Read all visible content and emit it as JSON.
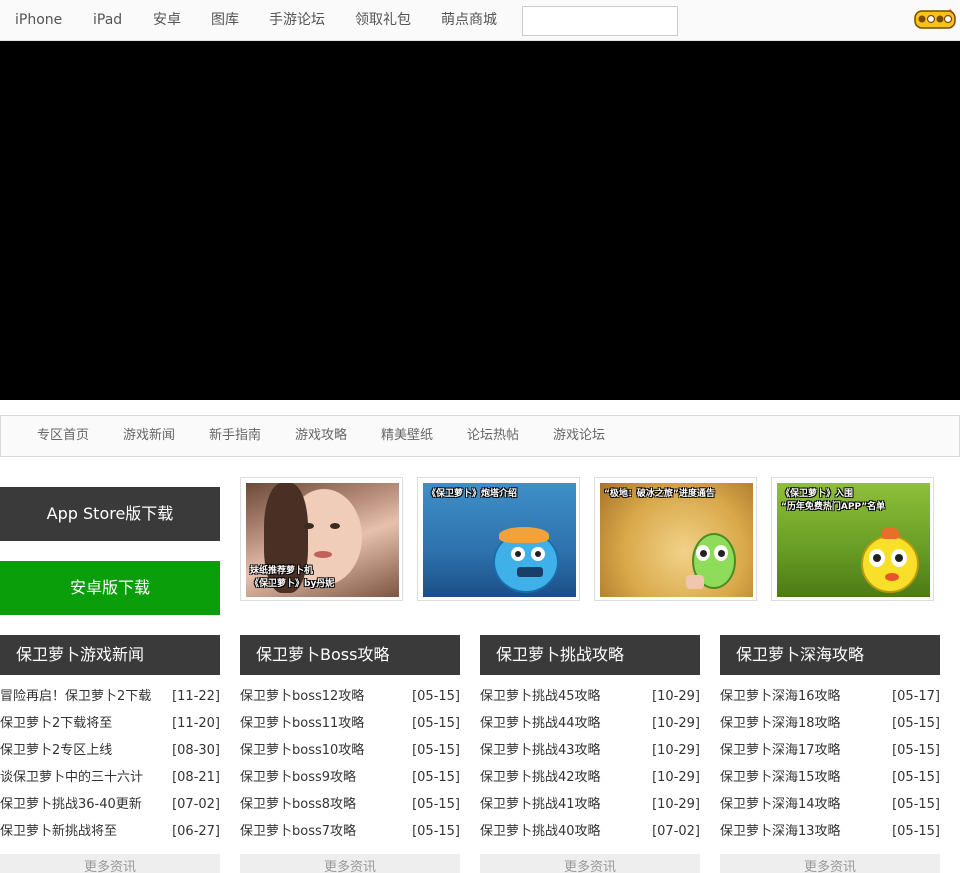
{
  "topnav": {
    "links": [
      "iPhone",
      "iPad",
      "安卓",
      "图库",
      "手游论坛",
      "领取礼包",
      "萌点商城"
    ],
    "search_value": ""
  },
  "subnav": [
    "专区首页",
    "游戏新闻",
    "新手指南",
    "游戏攻略",
    "精美壁纸",
    "论坛热帖",
    "游戏论坛"
  ],
  "downloads": {
    "ios_label": "App Store版下载",
    "android_label": "安卓版下载"
  },
  "thumbnails": [
    {
      "caption_line1": "妹纸推荐萝卜机",
      "caption_line2": "《保卫萝卜》by丹妮"
    },
    {
      "caption_line1": "《保卫萝卜》炮塔介绍",
      "caption_line2": ""
    },
    {
      "caption_line1": "“极地：破冰之旅”进度通告",
      "caption_line2": ""
    },
    {
      "caption_line1": "《保卫萝卜》入围",
      "caption_line2": "“历年免费热门APP”名单"
    }
  ],
  "columns": [
    {
      "title": "保卫萝卜游戏新闻",
      "items": [
        {
          "title": "冒险再启！保卫萝卜2下载",
          "date": "[11-22]"
        },
        {
          "title": "保卫萝卜2下载将至",
          "date": "[11-20]"
        },
        {
          "title": "保卫萝卜2专区上线",
          "date": "[08-30]"
        },
        {
          "title": "谈保卫萝卜中的三十六计",
          "date": "[08-21]"
        },
        {
          "title": "保卫萝卜挑战36-40更新",
          "date": "[07-02]"
        },
        {
          "title": "保卫萝卜新挑战将至",
          "date": "[06-27]"
        }
      ],
      "more": "更多资讯"
    },
    {
      "title": "保卫萝卜Boss攻略",
      "items": [
        {
          "title": "保卫萝卜boss12攻略",
          "date": "[05-15]"
        },
        {
          "title": "保卫萝卜boss11攻略",
          "date": "[05-15]"
        },
        {
          "title": "保卫萝卜boss10攻略",
          "date": "[05-15]"
        },
        {
          "title": "保卫萝卜boss9攻略",
          "date": "[05-15]"
        },
        {
          "title": "保卫萝卜boss8攻略",
          "date": "[05-15]"
        },
        {
          "title": "保卫萝卜boss7攻略",
          "date": "[05-15]"
        }
      ],
      "more": "更多资讯"
    },
    {
      "title": "保卫萝卜挑战攻略",
      "items": [
        {
          "title": "保卫萝卜挑战45攻略",
          "date": "[10-29]"
        },
        {
          "title": "保卫萝卜挑战44攻略",
          "date": "[10-29]"
        },
        {
          "title": "保卫萝卜挑战43攻略",
          "date": "[10-29]"
        },
        {
          "title": "保卫萝卜挑战42攻略",
          "date": "[10-29]"
        },
        {
          "title": "保卫萝卜挑战41攻略",
          "date": "[10-29]"
        },
        {
          "title": "保卫萝卜挑战40攻略",
          "date": "[07-02]"
        }
      ],
      "more": "更多资讯"
    },
    {
      "title": "保卫萝卜深海攻略",
      "items": [
        {
          "title": "保卫萝卜深海16攻略",
          "date": "[05-17]"
        },
        {
          "title": "保卫萝卜深海18攻略",
          "date": "[05-15]"
        },
        {
          "title": "保卫萝卜深海17攻略",
          "date": "[05-15]"
        },
        {
          "title": "保卫萝卜深海15攻略",
          "date": "[05-15]"
        },
        {
          "title": "保卫萝卜深海14攻略",
          "date": "[05-15]"
        },
        {
          "title": "保卫萝卜深海13攻略",
          "date": "[05-15]"
        }
      ],
      "more": "更多资讯"
    }
  ],
  "colors": {
    "dark_button": "#3a3a3a",
    "android_green": "#0a9e0a",
    "video_bg": "#000000"
  },
  "icons": {
    "logo": "18183-logo-icon"
  }
}
